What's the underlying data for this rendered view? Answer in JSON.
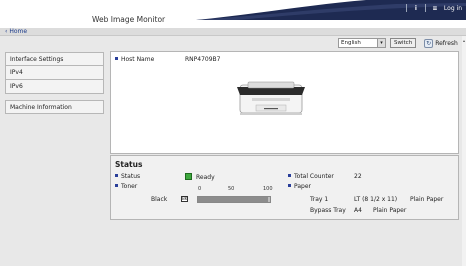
{
  "header": {
    "app_title": "Web Image Monitor",
    "info_icon": "info-icon",
    "menu_icon": "menu-icon",
    "login_label": "Log in"
  },
  "nav": {
    "home_label": "Home"
  },
  "controls": {
    "language_value": "English",
    "switch_label": "Switch",
    "refresh_label": "Refresh"
  },
  "sidebar": {
    "items": [
      {
        "label": "Interface Settings"
      },
      {
        "label": "IPv4"
      },
      {
        "label": "IPv6"
      },
      {
        "label": "Machine Information"
      }
    ]
  },
  "device": {
    "host_name_label": "Host Name",
    "host_name_value": "RNP4709B7"
  },
  "status": {
    "title": "Status",
    "status_label": "Status",
    "status_value": "Ready",
    "toner_label": "Toner",
    "toner_color": "Black",
    "toner_icon_text": "BK",
    "toner_scale": [
      "0",
      "50",
      "100"
    ],
    "toner_level": 0.97,
    "total_counter_label": "Total Counter",
    "total_counter_value": "22",
    "paper_label": "Paper",
    "paper": [
      {
        "tray": "Tray 1",
        "size": "LT (8 1/2 x 11)",
        "type": "Plain Paper"
      },
      {
        "tray": "Bypass Tray",
        "size": "A4",
        "type": "Plain Paper"
      }
    ]
  },
  "colors": {
    "brand_navy": "#1e2a52",
    "bullet_blue": "#2a3f9a",
    "ready_green": "#3ea83e"
  }
}
